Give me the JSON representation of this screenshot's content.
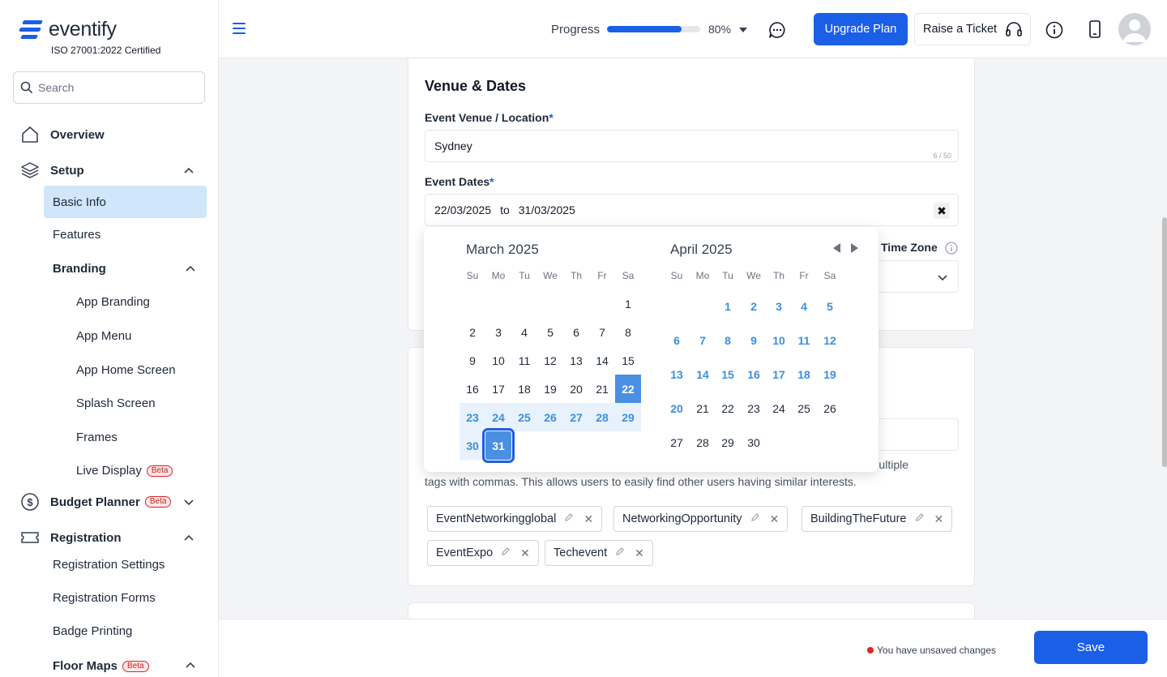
{
  "brand": {
    "name": "eventify",
    "certification": "ISO 27001:2022 Certified",
    "accent": "#1a5fe6"
  },
  "search": {
    "placeholder": "Search",
    "value": ""
  },
  "sidebar": {
    "overview": "Overview",
    "setup": "Setup",
    "basic_info": "Basic Info",
    "features": "Features",
    "branding": "Branding",
    "app_branding": "App Branding",
    "app_menu": "App Menu",
    "app_home_screen": "App Home Screen",
    "splash_screen": "Splash Screen",
    "frames": "Frames",
    "live_display": "Live Display",
    "budget_planner": "Budget Planner",
    "registration": "Registration",
    "registration_settings": "Registration Settings",
    "registration_forms": "Registration Forms",
    "badge_printing": "Badge Printing",
    "floor_maps": "Floor Maps",
    "beta_label": "Beta"
  },
  "header": {
    "progress_label": "Progress",
    "progress_value": 80,
    "progress_text": "80%",
    "upgrade_label": "Upgrade Plan",
    "ticket_label": "Raise a Ticket"
  },
  "venue_card": {
    "title": "Venue & Dates",
    "venue_label": "Event Venue / Location",
    "required_mark": "*",
    "venue_value": "Sydney",
    "venue_counter": "6 / 50",
    "dates_label": "Event Dates",
    "date_from": "22/03/2025",
    "date_sep": "to",
    "date_to": "31/03/2025",
    "timezone_label": "Time Zone"
  },
  "tags_card": {
    "helper_partial": "parate multiple",
    "helper_line2": "tags with commas. This allows users to easily find other users having similar interests.",
    "tags": [
      "EventNetworkingglobal",
      "NetworkingOpportunity",
      "BuildingTheFuture",
      "EventExpo",
      "Techevent"
    ]
  },
  "calendar": {
    "left_month": "March 2025",
    "right_month": "April 2025",
    "weekdays": [
      "Su",
      "Mo",
      "Tu",
      "We",
      "Th",
      "Fr",
      "Sa"
    ],
    "march_days": [
      "1",
      "2",
      "3",
      "4",
      "5",
      "6",
      "7",
      "8",
      "9",
      "10",
      "11",
      "12",
      "13",
      "14",
      "15",
      "16",
      "17",
      "18",
      "19",
      "20",
      "21",
      "22",
      "23",
      "24",
      "25",
      "26",
      "27",
      "28",
      "29",
      "30",
      "31"
    ],
    "april_days": [
      "1",
      "2",
      "3",
      "4",
      "5",
      "6",
      "7",
      "8",
      "9",
      "10",
      "11",
      "12",
      "13",
      "14",
      "15",
      "16",
      "17",
      "18",
      "19",
      "20",
      "21",
      "22",
      "23",
      "24",
      "25",
      "26",
      "27",
      "28",
      "29",
      "30"
    ]
  },
  "footer": {
    "unsaved": "You have unsaved changes",
    "save_label": "Save"
  }
}
